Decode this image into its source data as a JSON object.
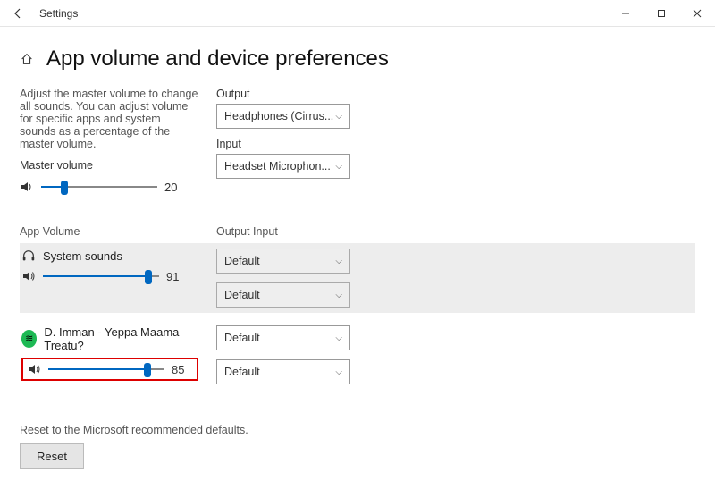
{
  "window": {
    "title": "Settings"
  },
  "page": {
    "heading": "App volume and device preferences",
    "intro": "Adjust the master volume to change all sounds. You can adjust volume for specific apps and system sounds as a percentage of the master volume.",
    "master_label": "Master volume",
    "master_value": "20",
    "output_label": "Output",
    "output_value": "Headphones (Cirrus...",
    "input_label": "Input",
    "input_value": "Headset Microphon...",
    "col1_label": "App Volume",
    "col2_label": "Output Input",
    "apps": [
      {
        "name": "System sounds",
        "volume": "91",
        "output": "Default",
        "input": "Default"
      },
      {
        "name": "D. Imman - Yeppa Maama Treatu?",
        "volume": "85",
        "output": "Default",
        "input": "Default"
      }
    ],
    "reset_text": "Reset to the Microsoft recommended defaults.",
    "reset_button": "Reset"
  }
}
